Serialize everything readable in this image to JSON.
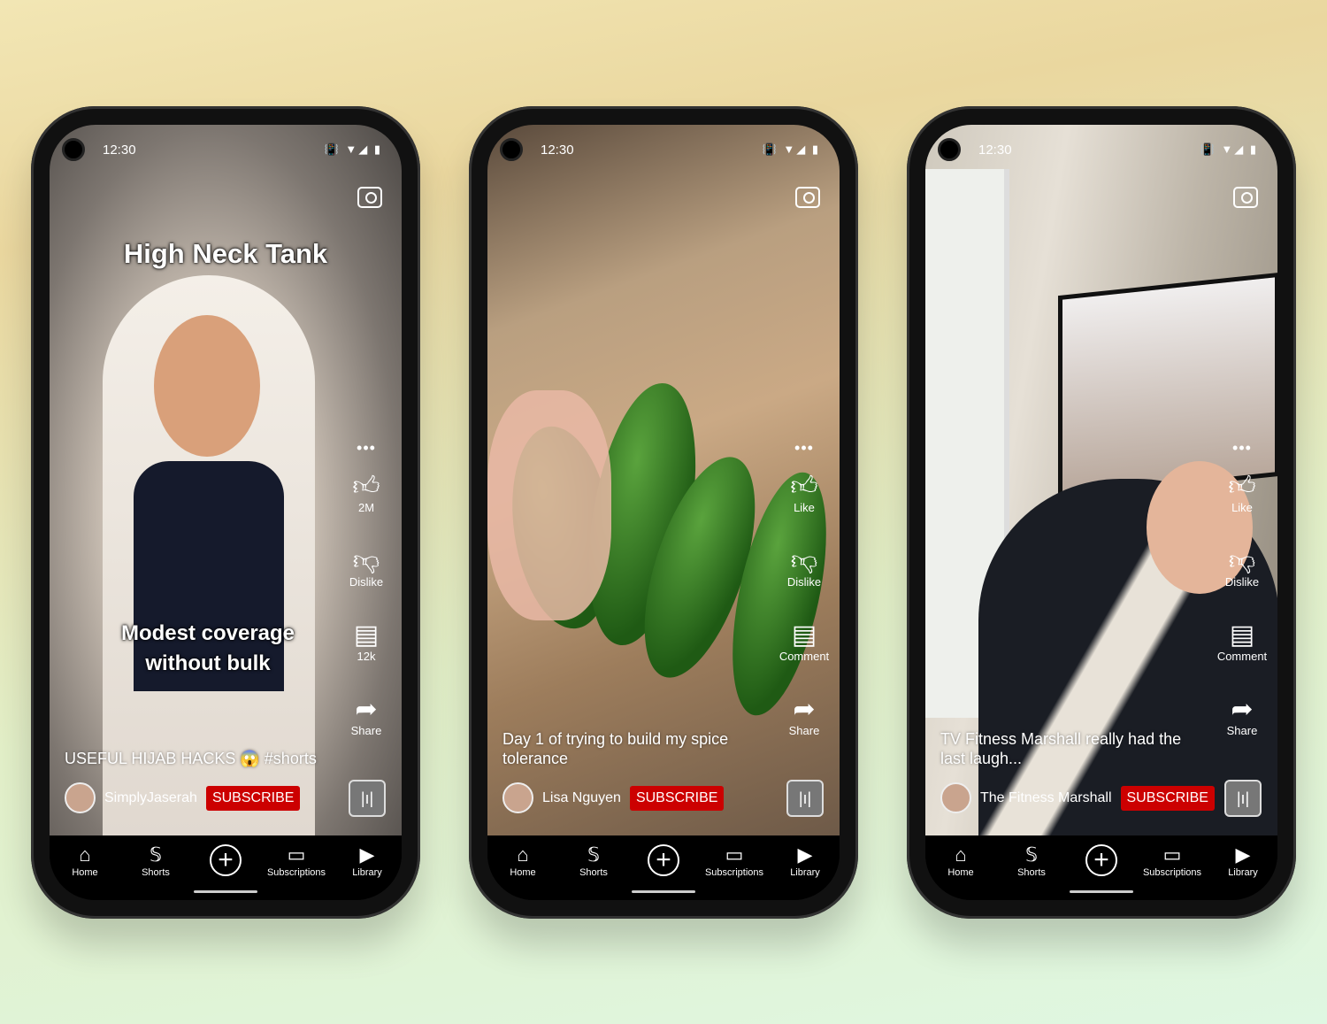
{
  "status": {
    "time": "12:30",
    "icons": "vibrate wifi signal battery"
  },
  "nav": {
    "home": "Home",
    "shorts": "Shorts",
    "create": "+",
    "subscriptions": "Subscriptions",
    "library": "Library"
  },
  "subscribe_label": "SUBSCRIBE",
  "subscribe_color": "#cc0000",
  "phones": [
    {
      "overlay_top": "High Neck Tank",
      "overlay_mid": "Modest coverage without bulk",
      "like": "2M",
      "dislike": "Dislike",
      "comment": "12k",
      "share": "Share",
      "caption": "USEFUL HIJAB HACKS  😱 #shorts",
      "channel": "SimplyJaserah"
    },
    {
      "overlay_top": "",
      "overlay_mid": "",
      "like": "Like",
      "dislike": "Dislike",
      "comment": "Comment",
      "share": "Share",
      "caption": "Day 1 of trying to build my spice tolerance",
      "channel": "Lisa Nguyen"
    },
    {
      "overlay_top": "",
      "overlay_mid": "",
      "like": "Like",
      "dislike": "Dislike",
      "comment": "Comment",
      "share": "Share",
      "caption": "TV Fitness Marshall really had the last laugh...",
      "channel": "The Fitness Marshall"
    }
  ]
}
